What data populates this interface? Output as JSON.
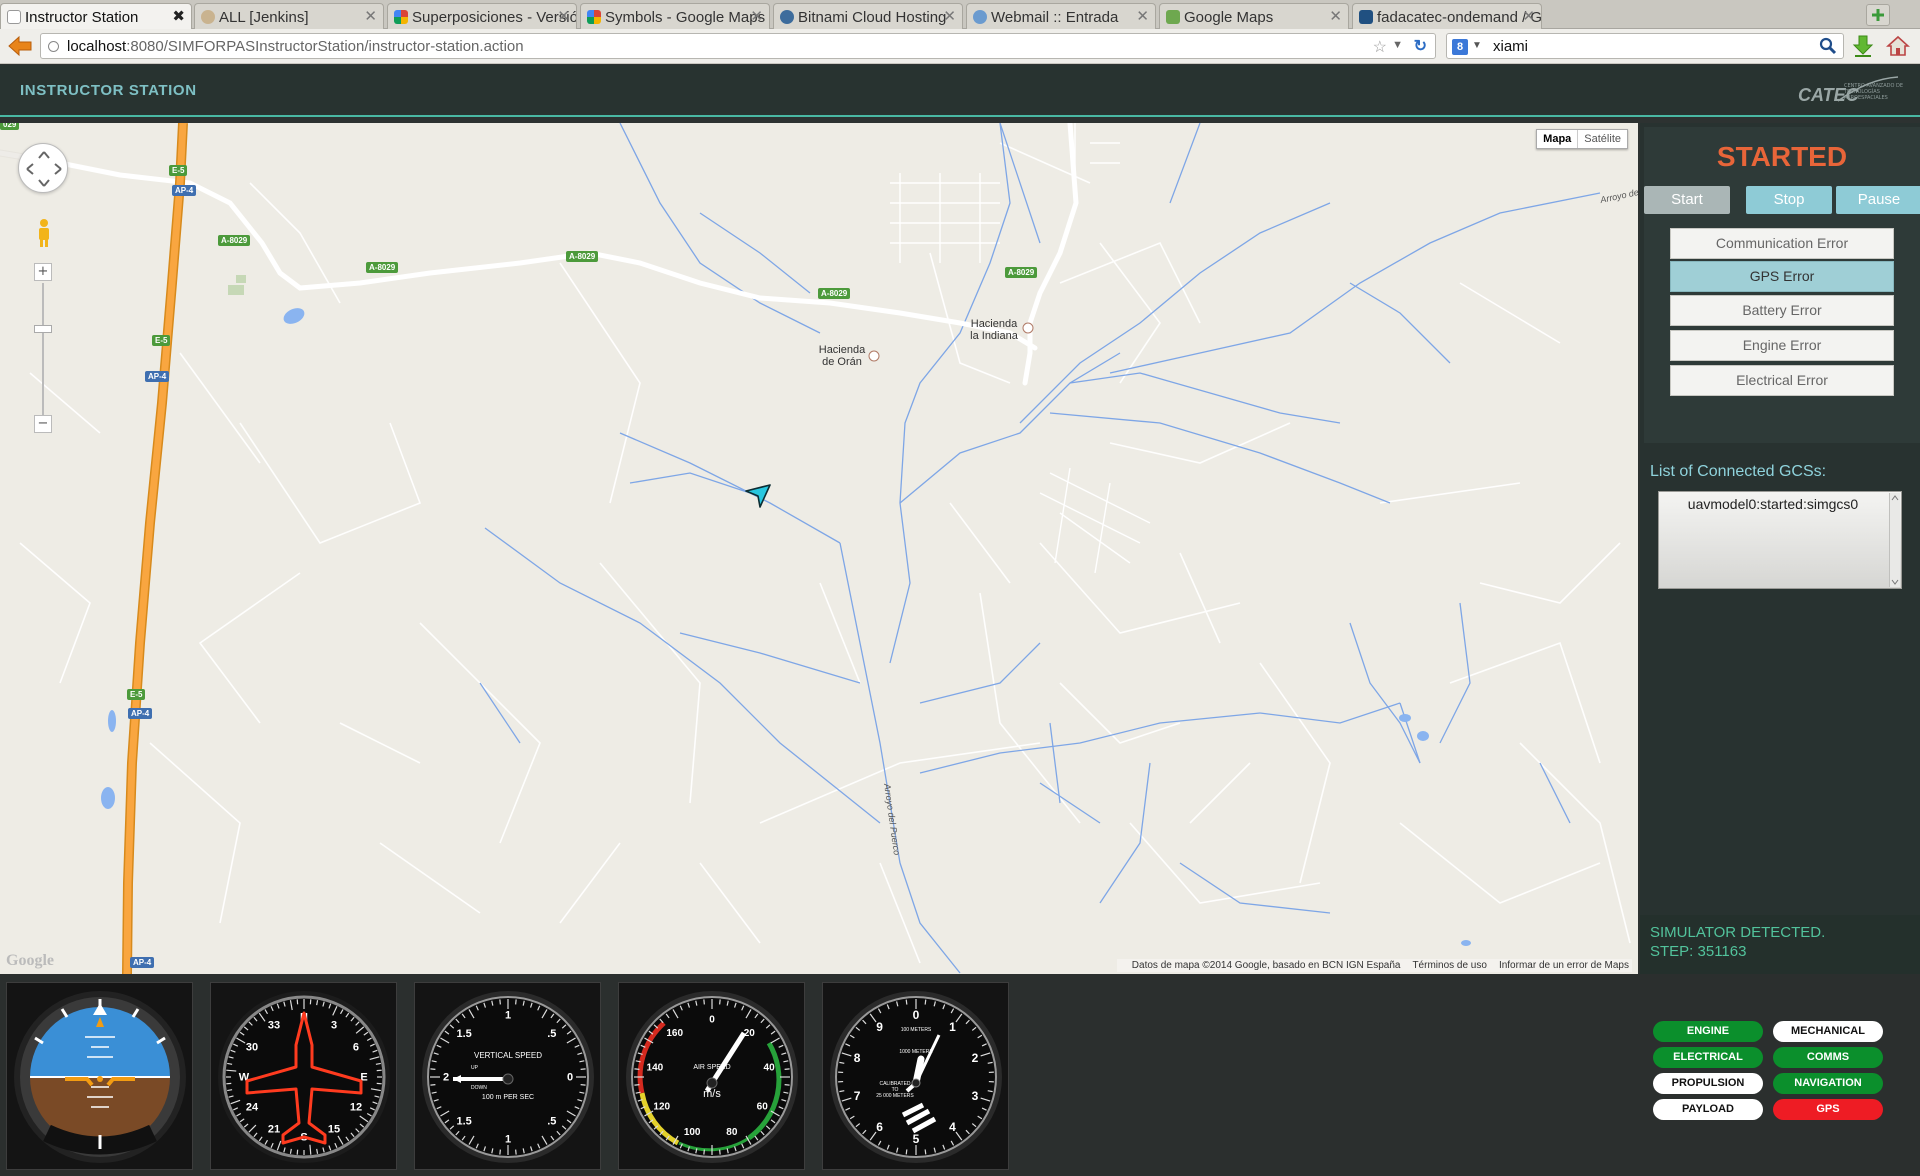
{
  "browser": {
    "tabs": [
      {
        "label": "Instructor Station",
        "active": true,
        "icon": "page-icon"
      },
      {
        "label": "ALL [Jenkins]",
        "icon": "jenkins-icon"
      },
      {
        "label": "Superposiciones - Versió…",
        "icon": "google-dev-icon"
      },
      {
        "label": "Symbols - Google Maps J…",
        "icon": "google-dev-icon"
      },
      {
        "label": "Bitnami Cloud Hosting",
        "icon": "bitnami-icon"
      },
      {
        "label": "Webmail :: Entrada",
        "icon": "webmail-icon"
      },
      {
        "label": "Google Maps",
        "icon": "maps-icon"
      },
      {
        "label": "fadacatec-ondemand / G…",
        "icon": "bitbucket-icon"
      }
    ],
    "url_host": "localhost",
    "url_path": ":8080/SIMFORPASInstructorStation/instructor-station.action",
    "search_value": "xiami"
  },
  "app": {
    "title": "INSTRUCTOR STATION",
    "logo_text": "CATEC",
    "logo_subtitle": "CENTRO AVANZADO DE TECNOLOGÍAS AEROESPACIALES"
  },
  "map": {
    "type_buttons": [
      "Mapa",
      "Satélite"
    ],
    "zoom_in": "+",
    "zoom_out": "−",
    "google_logo": "Google",
    "attribution": [
      "Datos de mapa ©2014 Google, basado en BCN IGN España",
      "Términos de uso",
      "Informar de un error de Maps"
    ],
    "places": [
      {
        "name": "Hacienda la Indiana",
        "line1": "Hacienda",
        "line2": "la Indiana"
      },
      {
        "name": "Hacienda de Orán",
        "line1": "Hacienda",
        "line2": "de Orán"
      }
    ],
    "road_shields": {
      "a8029": "A-8029",
      "e5": "E-5",
      "ap4": "AP-4",
      "corner": "029"
    },
    "streams": [
      "Arroyo del Puerco",
      "Arroyo de"
    ]
  },
  "controls": {
    "state": "STARTED",
    "state_color": "#e86539",
    "buttons": [
      "Start",
      "Stop",
      "Pause"
    ],
    "errors": [
      "Communication Error",
      "GPS Error",
      "Battery Error",
      "Engine Error",
      "Electrical Error"
    ],
    "selected_error": "GPS Error",
    "gcs_label": "List of Connected GCSs:",
    "gcs_items": [
      "uavmodel0:started:simgcs0"
    ],
    "sim_status": "SIMULATOR DETECTED.",
    "step_label": "STEP: 351163"
  },
  "instruments": {
    "vsi": {
      "title": "VERTICAL SPEED",
      "unit": "100 m PER SEC",
      "up": "UP",
      "down": "DOWN",
      "ticks": [
        "1",
        ".5",
        "0",
        ".5",
        "1",
        "1.5",
        "2",
        "1.5"
      ]
    },
    "asi": {
      "title": "AIR SPEED",
      "unit": "m/s",
      "ticks": [
        "0",
        "20",
        "40",
        "60",
        "80",
        "100",
        "120",
        "140",
        "160"
      ]
    },
    "alt": {
      "title": "100 METERS",
      "sub1": "1000 METERS",
      "cal1": "CALIBRATED",
      "cal2": "TO",
      "cal3": "25 000 METERS",
      "ticks": [
        "0",
        "1",
        "2",
        "3",
        "4",
        "5",
        "6",
        "7",
        "8",
        "9"
      ]
    },
    "hdg": {
      "ticks": [
        "N",
        "3",
        "6",
        "E",
        "12",
        "15",
        "S",
        "21",
        "24",
        "W",
        "30",
        "33"
      ]
    }
  },
  "status_badges": [
    {
      "label": "ENGINE",
      "state": "ok"
    },
    {
      "label": "MECHANICAL",
      "state": "neutral"
    },
    {
      "label": "ELECTRICAL",
      "state": "ok"
    },
    {
      "label": "COMMS",
      "state": "ok"
    },
    {
      "label": "PROPULSION",
      "state": "neutral"
    },
    {
      "label": "NAVIGATION",
      "state": "ok"
    },
    {
      "label": "PAYLOAD",
      "state": "neutral"
    },
    {
      "label": "GPS",
      "state": "fault"
    }
  ],
  "colors": {
    "ok": "#0b8f2c",
    "fault": "#ee1c24",
    "accent": "#49b8a3"
  }
}
